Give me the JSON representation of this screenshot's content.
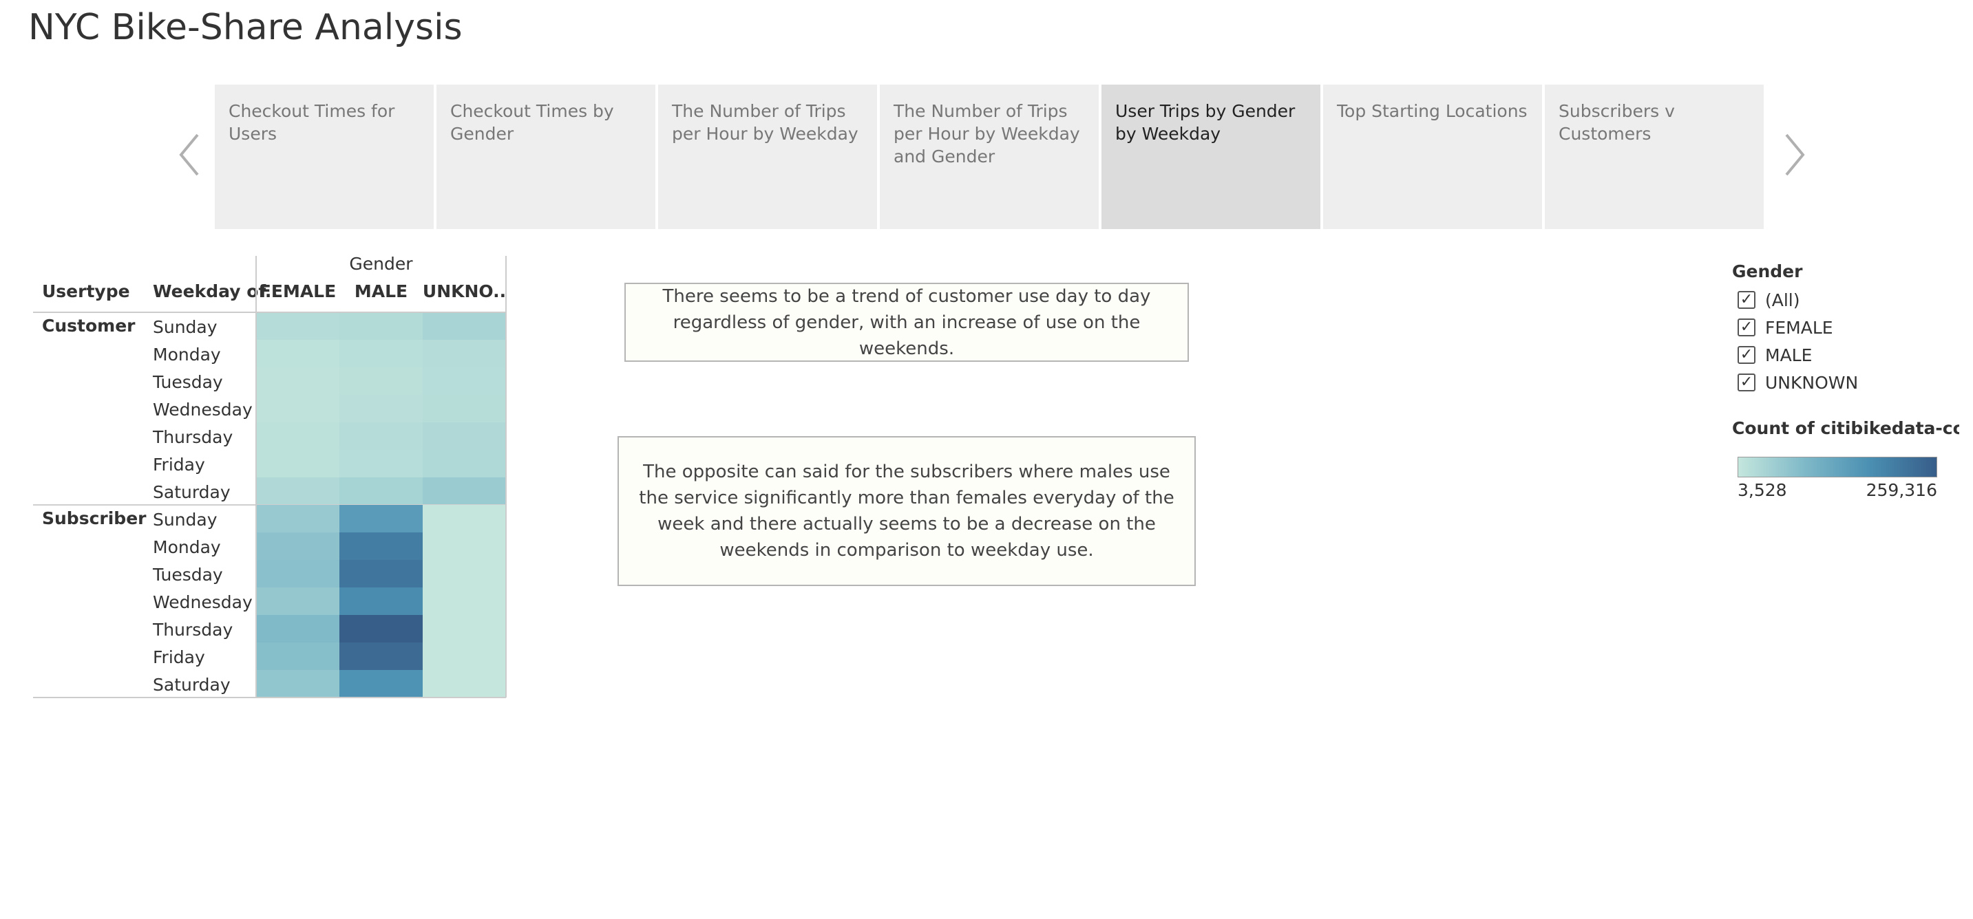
{
  "page": {
    "title": "NYC Bike-Share Analysis"
  },
  "nav": {
    "tabs": [
      {
        "label": "Checkout Times for Users",
        "active": false
      },
      {
        "label": "Checkout Times by Gender",
        "active": false
      },
      {
        "label": "The Number of Trips per Hour by Weekday",
        "active": false
      },
      {
        "label": "The Number of Trips per Hour by Weekday and Gender",
        "active": false
      },
      {
        "label": "User Trips by Gender by Weekday",
        "active": true
      },
      {
        "label": "Top Starting Locations",
        "active": false
      },
      {
        "label": "Subscribers v Customers",
        "active": false
      }
    ],
    "prev_icon": "chevron-left-icon",
    "next_icon": "chevron-right-icon"
  },
  "filter": {
    "title": "Gender",
    "options": [
      {
        "label": "(All)",
        "checked": true
      },
      {
        "label": "FEMALE",
        "checked": true
      },
      {
        "label": "MALE",
        "checked": true
      },
      {
        "label": "UNKNOWN",
        "checked": true
      }
    ]
  },
  "legend": {
    "title": "Count of citibikedata-con...",
    "min_label": "3,528",
    "max_label": "259,316",
    "colors": [
      "#c4e6dd",
      "#7fb9c8",
      "#4a8fb2",
      "#375d89"
    ]
  },
  "annotations": [
    "There seems to be a trend of customer use day to day regardless of gender, with an increase of use on the weekends.",
    "The opposite can said for the subscribers where males use the service significantly more than females everyday of the week and there actually seems to be a decrease on the weekends in comparison to weekday use."
  ],
  "chart_data": {
    "type": "heatmap",
    "column_group_header": "Gender",
    "row_headers": [
      "Usertype",
      "Weekday of.."
    ],
    "columns": [
      "FEMALE",
      "MALE",
      "UNKNO.."
    ],
    "min": 3528,
    "max": 259316,
    "groups": [
      {
        "name": "Customer",
        "rows": [
          {
            "weekday": "Sunday",
            "values": [
              22000,
              26000,
              38000
            ]
          },
          {
            "weekday": "Monday",
            "values": [
              12000,
              17000,
              22000
            ]
          },
          {
            "weekday": "Tuesday",
            "values": [
              10000,
              15000,
              21000
            ]
          },
          {
            "weekday": "Wednesday",
            "values": [
              10000,
              16000,
              20000
            ]
          },
          {
            "weekday": "Thursday",
            "values": [
              14000,
              22000,
              30000
            ]
          },
          {
            "weekday": "Friday",
            "values": [
              14000,
              21000,
              29000
            ]
          },
          {
            "weekday": "Saturday",
            "values": [
              30000,
              40000,
              55000
            ]
          }
        ]
      },
      {
        "name": "Subscriber",
        "rows": [
          {
            "weekday": "Sunday",
            "values": [
              58000,
              150000,
              3528
            ]
          },
          {
            "weekday": "Monday",
            "values": [
              72000,
              205000,
              4000
            ]
          },
          {
            "weekday": "Tuesday",
            "values": [
              75000,
              218000,
              4000
            ]
          },
          {
            "weekday": "Wednesday",
            "values": [
              62000,
              180000,
              4000
            ]
          },
          {
            "weekday": "Thursday",
            "values": [
              88000,
              259316,
              4000
            ]
          },
          {
            "weekday": "Friday",
            "values": [
              80000,
              238000,
              4000
            ]
          },
          {
            "weekday": "Saturday",
            "values": [
              65000,
              168000,
              3600
            ]
          }
        ]
      }
    ]
  }
}
